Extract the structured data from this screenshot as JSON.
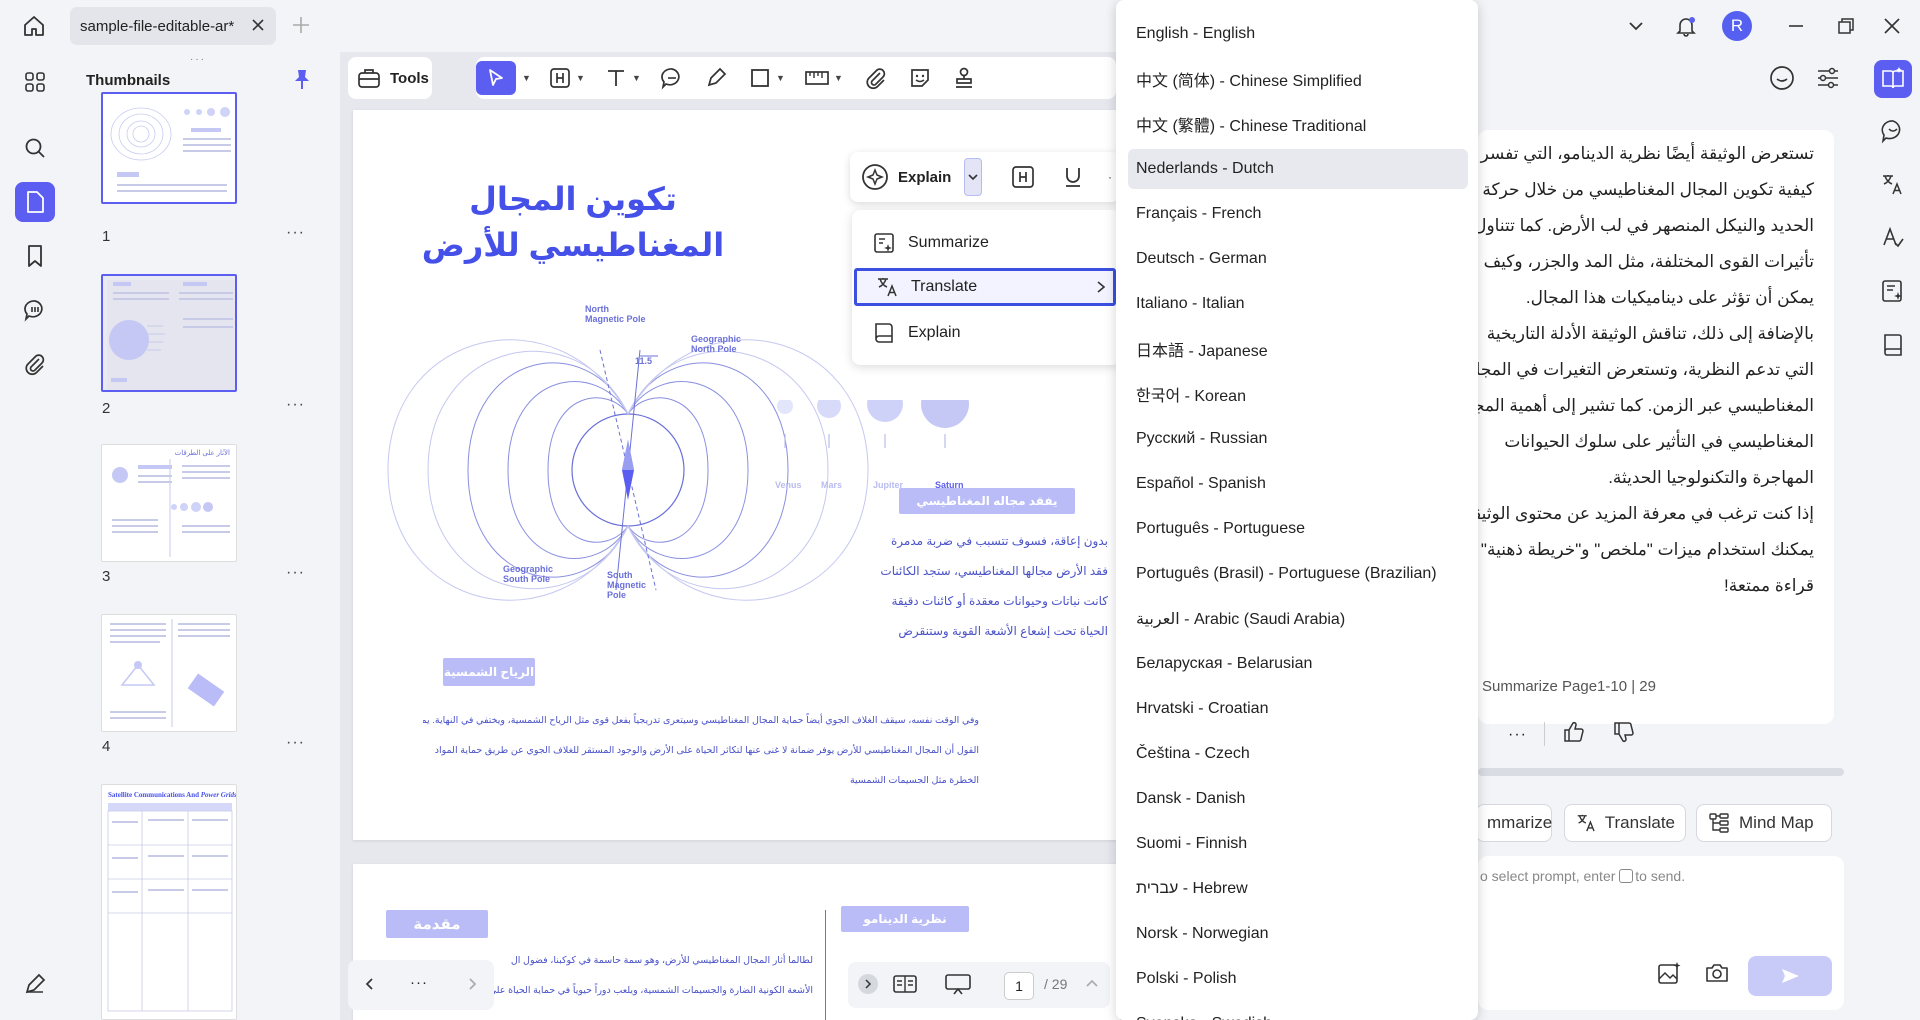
{
  "tab": {
    "title": "sample-file-editable-ar*"
  },
  "user": {
    "avatar_letter": "R"
  },
  "thumbnails": {
    "title": "Thumbnails",
    "pages": [
      {
        "num": "1",
        "more": "···"
      },
      {
        "num": "2",
        "more": "···"
      },
      {
        "num": "3",
        "more": "···"
      },
      {
        "num": "4",
        "more": "···"
      }
    ],
    "thumb3_heading": "الآثار على الطرقات",
    "thumb5_heading_a": "Satellite Communications And ",
    "thumb5_heading_b": "Power Grids"
  },
  "toolbar": {
    "tools_label": "Tools"
  },
  "page": {
    "title_line1": "تكوين المجال",
    "title_line2": "المغناطيسي للأرض",
    "diagram": {
      "north_magnetic": "North\nMagnetic Pole",
      "geo_north": "Geographic\nNorth Pole",
      "geo_south": "Geographic\nSouth Pole",
      "south_magnetic": "South\nMagnetic\nPole",
      "angle": "11.5"
    },
    "planets": [
      "Venus",
      "Mars",
      "Jupiter",
      "Saturn"
    ],
    "pill_loss": "يفقد مجاله المغناطيسي",
    "loss_lines": [
      "بدون إعاقة، فسوف تتسبب في ضربة مدمرة",
      "فقد الأرض مجالها المغناطيسي، ستجد الكائنات",
      "كانت نباتات وحيوانات معقدة أو كائنات دقيقة",
      "الحياة تحت إشعاع الأشعة القوية وستنقرض"
    ],
    "pill_wind": "الرياح الشمسية",
    "wind_lines": [
      "وفي الوقت نفسه، سيقف الغلاف الجوي أيضاً حماية المجال المغناطيسي وسيتعرى تدريجياً بفعل قوى مثل الرياح الشمسية، ويختفي في النهاية. يمكن",
      "القول أن المجال المغناطيسي للأرض يوفر ضمانة لا غنى عنها لتكاثر الحياة على الأرض والوجود المستقر للغلاف الجوي عن طريق حماية المواد",
      "الخطرة مثل الجسيمات الشمسية"
    ],
    "pill_intro": "مقدمة",
    "pill_dynamo": "نظرية الدينامو",
    "intro_lines": [
      "لطالما أثار المجال المغناطيسي للأرض، وهو سمة حاسمة في كوكبنا، فضول ال",
      "الأشعة الكونية الضارة والجسيمات الشمسية، ويلعب دوراً حيوياً في حماية الحياة على الأرض"
    ]
  },
  "popup": {
    "explain_label": "Explain",
    "menu": [
      {
        "label": "Summarize",
        "icon": "summarize-icon"
      },
      {
        "label": "Translate",
        "icon": "translate-icon"
      },
      {
        "label": "Explain",
        "icon": "book-icon"
      }
    ]
  },
  "languages": [
    "English - English",
    "中文 (简体) - Chinese Simplified",
    "中文 (繁體) - Chinese Traditional",
    "Nederlands - Dutch",
    "Français - French",
    "Deutsch - German",
    "Italiano - Italian",
    "日本語 - Japanese",
    "한국어 - Korean",
    "Русский - Russian",
    "Español - Spanish",
    "Português - Portuguese",
    "Português (Brasil) - Portuguese (Brazilian)",
    "العربية - Arabic (Saudi Arabia)",
    "Беларуская - Belarusian",
    "Hrvatski - Croatian",
    "Čeština - Czech",
    "Dansk - Danish",
    "Suomi - Finnish",
    "עברית - Hebrew",
    "Norsk - Norwegian",
    "Polski - Polish",
    "Svenska - Swedish"
  ],
  "ai_panel": {
    "lines": [
      "تستعرض الوثيقة أيضًا نظرية الدينامو، التي تفسر",
      "كيفية تكوين المجال المغناطيسي من خلال حركة",
      "الحديد والنيكل المنصهر في لب الأرض. كما تتناول",
      "تأثيرات القوى المختلفة، مثل المد والجزر، وكيف",
      "يمكن أن تؤثر على ديناميكيات هذا المجال.",
      "بالإضافة إلى ذلك، تناقش الوثيقة الأدلة التاريخية",
      "التي تدعم النظرية، وتستعرض التغيرات في المجال",
      "المغناطيسي عبر الزمن. كما تشير إلى أهمية المجال",
      "المغناطيسي في التأثير على سلوك الحيوانات",
      "المهاجرة والتكنولوجيا الحديثة.",
      "إذا كنت ترغب في معرفة المزيد عن محتوى الوثيقة،",
      "يمكنك استخدام ميزات \"ملخص\" و\"خريطة ذهنية\"",
      "قراءة ممتعة!"
    ],
    "summary_ref": "Summarize Page1-10 | 29",
    "chips": [
      "mmarize",
      "Translate",
      "Mind Map"
    ],
    "input_hint_a": "o select prompt, enter ",
    "input_hint_b": "to send."
  },
  "pagination": {
    "current": "1",
    "total": "/ 29"
  },
  "colors": {
    "accent": "#5b5ef0",
    "doc_text": "#4550e8"
  }
}
